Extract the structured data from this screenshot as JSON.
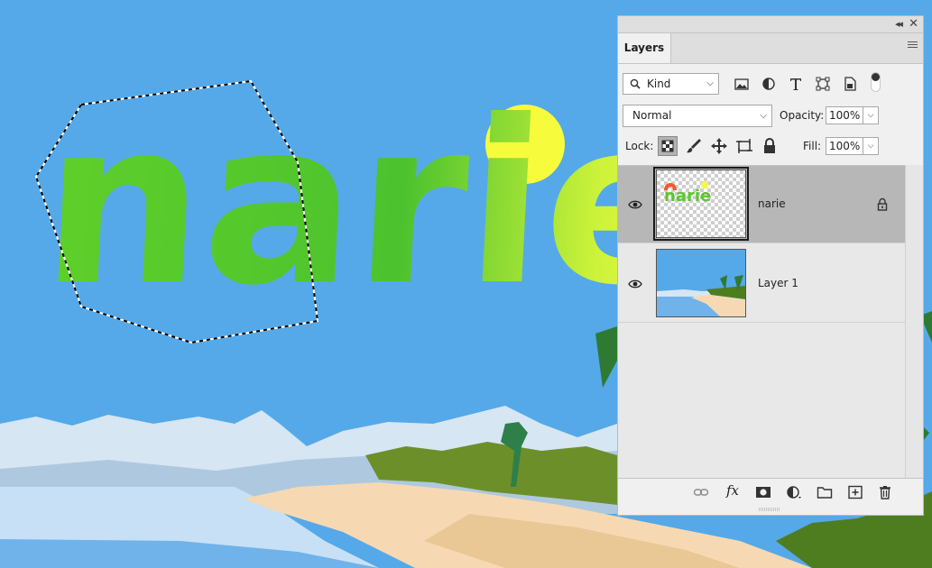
{
  "canvas": {
    "text": "narie",
    "colors": {
      "sky": "#55a9e8",
      "text_orange": "#f05a2a",
      "text_green": "#46c22e",
      "text_yellow": "#eef842",
      "sun": "#f6fb3c"
    }
  },
  "panel": {
    "tab_label": "Layers",
    "icons": {
      "collapse": "collapse-panel-icon",
      "close": "close-icon",
      "menu": "panel-menu-icon"
    },
    "filter": {
      "kind_label": "Kind",
      "icons": [
        "image-filter-icon",
        "adjustment-filter-icon",
        "type-filter-icon",
        "shape-filter-icon",
        "smart-object-filter-icon"
      ]
    },
    "blend_mode": "Normal",
    "opacity_label": "Opacity:",
    "opacity_value": "100%",
    "lock_label": "Lock:",
    "fill_label": "Fill:",
    "fill_value": "100%",
    "lock_icons": [
      "lock-transparent-pixels-icon",
      "lock-image-pixels-icon",
      "lock-position-icon",
      "lock-artboard-icon",
      "lock-all-icon"
    ],
    "layers": [
      {
        "name": "narie",
        "selected": true,
        "locked": true,
        "thumb": "transparent-text-thumbnail"
      },
      {
        "name": "Layer 1",
        "selected": false,
        "locked": false,
        "thumb": "beach-thumbnail"
      }
    ],
    "bottom_icons": [
      "link-layers-icon",
      "fx-icon",
      "layer-mask-icon",
      "adjustment-layer-icon",
      "new-group-icon",
      "new-layer-icon",
      "trash-icon"
    ],
    "fx_label": "fx"
  }
}
